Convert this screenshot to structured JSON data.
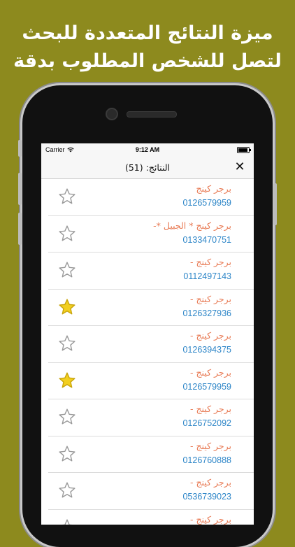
{
  "promo": {
    "line1": "ميزة النتائج المتعددة للبحث",
    "line2": "لتصل للشخص المطلوب بدقة"
  },
  "status_bar": {
    "carrier": "Carrier",
    "wifi_icon": "wifi-icon",
    "time": "9:12 AM",
    "battery_icon": "battery-icon"
  },
  "nav": {
    "title": "النتائج: (51)",
    "close": "✕"
  },
  "colors": {
    "background": "#8d8a1e",
    "name": "#e87a54",
    "phone": "#2e86c8",
    "star_filled": "#f2cf1f",
    "star_empty": "#9a9a9a"
  },
  "results": [
    {
      "name": "برجر كينج",
      "phone": "0126579959",
      "favorite": false
    },
    {
      "name": "برجر كينج * الجبيل *-",
      "phone": "0133470751",
      "favorite": false
    },
    {
      "name": "برجر كينج -",
      "phone": "0112497143",
      "favorite": false
    },
    {
      "name": "برجر كينج -",
      "phone": "0126327936",
      "favorite": true
    },
    {
      "name": "برجر كينج -",
      "phone": "0126394375",
      "favorite": false
    },
    {
      "name": "برجر كينج -",
      "phone": "0126579959",
      "favorite": true
    },
    {
      "name": "برجر كينج -",
      "phone": "0126752092",
      "favorite": false
    },
    {
      "name": "برجر كينج -",
      "phone": "0126760888",
      "favorite": false
    },
    {
      "name": "برجر كينج -",
      "phone": "0536739023",
      "favorite": false
    },
    {
      "name": "برجر كينج -",
      "phone": "",
      "favorite": false
    }
  ]
}
